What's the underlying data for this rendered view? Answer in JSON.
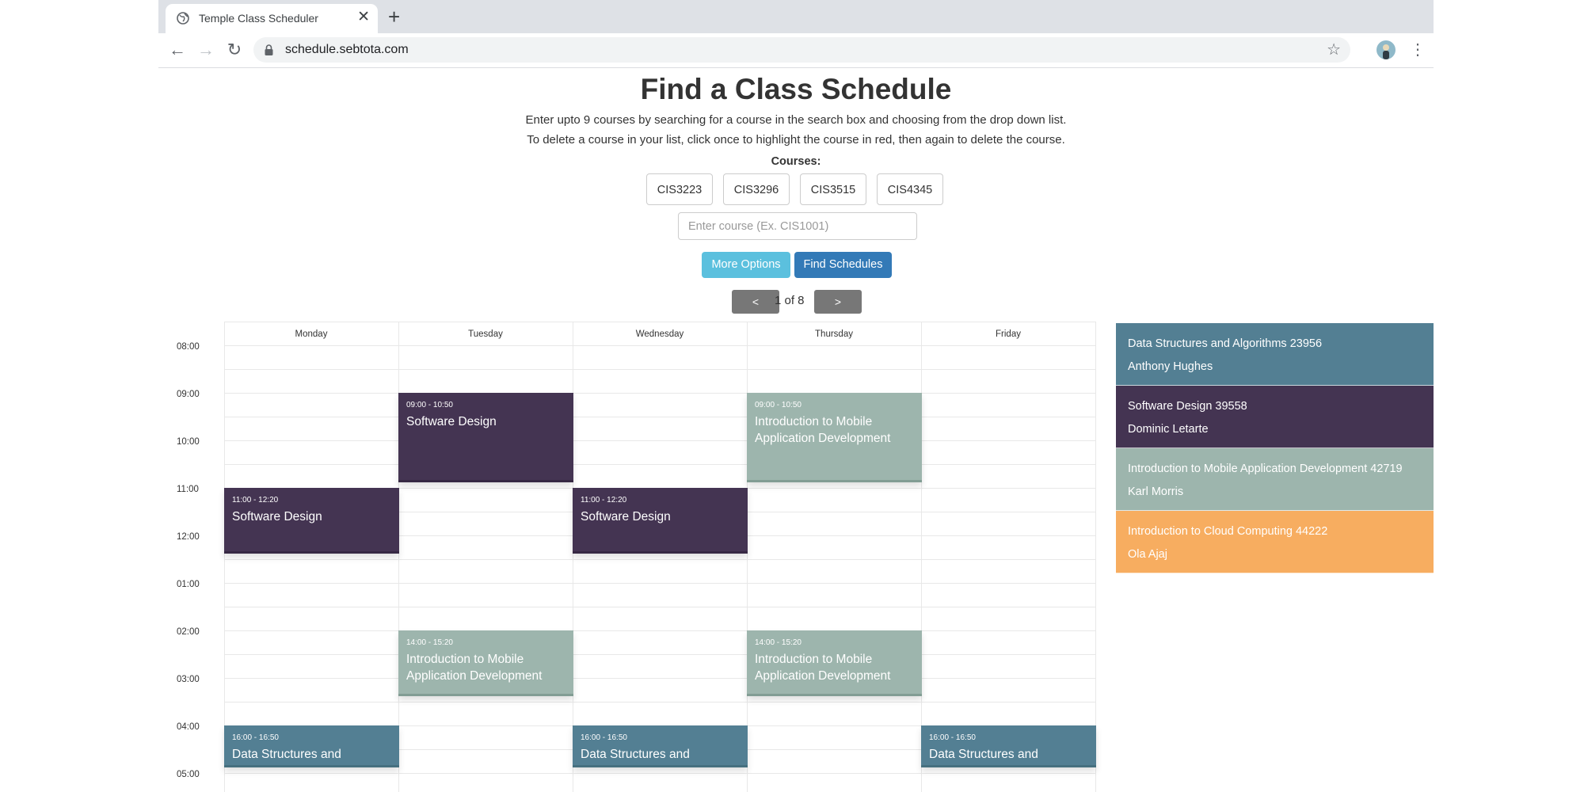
{
  "browser": {
    "tab_title": "Temple Class Scheduler",
    "tab_close": "✕",
    "new_tab": "+",
    "url": "schedule.sebtota.com"
  },
  "page": {
    "title": "Find a Class Schedule",
    "instruction_1": "Enter upto 9 courses by searching for a course in the search box and choosing from the drop down list.",
    "instruction_2": "To delete a course in your list, click once to highlight the course in red, then again to delete the course.",
    "courses_label": "Courses:",
    "courses": [
      "CIS3223",
      "CIS3296",
      "CIS3515",
      "CIS4345"
    ],
    "course_input_placeholder": "Enter course (Ex. CIS1001)",
    "more_options_label": "More Options",
    "find_schedules_label": "Find Schedules",
    "prev_label": "<",
    "next_label": ">",
    "pager_text": "1 of 8"
  },
  "calendar": {
    "days": [
      "Monday",
      "Tuesday",
      "Wednesday",
      "Thursday",
      "Friday"
    ],
    "times": [
      "08:00",
      "09:00",
      "10:00",
      "11:00",
      "12:00",
      "01:00",
      "02:00",
      "03:00",
      "04:00",
      "05:00"
    ],
    "events": [
      {
        "time": "09:00 - 10:50",
        "name": "Software Design",
        "course": "sd"
      },
      {
        "time": "09:00 - 10:50",
        "name": "Introduction to Mobile Application Development",
        "course": "mob"
      },
      {
        "time": "11:00 - 12:20",
        "name": "Software Design",
        "course": "sd"
      },
      {
        "time": "11:00 - 12:20",
        "name": "Software Design",
        "course": "sd"
      },
      {
        "time": "14:00 - 15:20",
        "name": "Introduction to Mobile Application Development",
        "course": "mob"
      },
      {
        "time": "14:00 - 15:20",
        "name": "Introduction to Mobile Application Development",
        "course": "mob"
      },
      {
        "time": "16:00 - 16:50",
        "name": "Data Structures and",
        "course": "ds"
      },
      {
        "time": "16:00 - 16:50",
        "name": "Data Structures and",
        "course": "ds"
      },
      {
        "time": "16:00 - 16:50",
        "name": "Data Structures and",
        "course": "ds"
      }
    ]
  },
  "legend": [
    {
      "course": "Data Structures and Algorithms 23956",
      "instructor": "Anthony Hughes",
      "color": "#537f93"
    },
    {
      "course": "Software Design 39558",
      "instructor": "Dominic Letarte",
      "color": "#443452"
    },
    {
      "course": "Introduction to Mobile Application Development 42719",
      "instructor": "Karl Morris",
      "color": "#9db5ad"
    },
    {
      "course": "Introduction to Cloud Computing 44222",
      "instructor": "Ola Ajaj",
      "color": "#f7ad60"
    }
  ],
  "colors": {
    "ds": "#537f93",
    "sd": "#443452",
    "mob": "#9db5ad",
    "cloud": "#f7ad60",
    "more_options": "#5bc0de",
    "find_schedules": "#337ab7"
  }
}
